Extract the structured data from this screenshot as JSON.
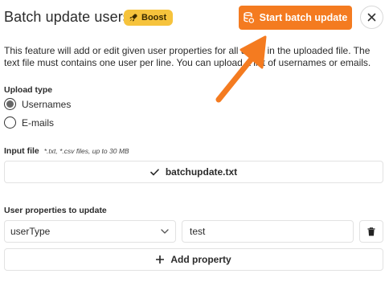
{
  "header": {
    "title": "Batch update users",
    "badge_label": "Boost",
    "badge_icon": "rocket-icon",
    "start_button_label": "Start batch update",
    "start_button_icon": "database-sync-icon",
    "close_icon": "close-icon",
    "accent_color": "#f47b20",
    "badge_color": "#f6c33c"
  },
  "description": "This feature will add or edit given user properties for all users in the uploaded file. The text file must contains one user per line. You can upload a list of usernames or emails.",
  "upload_type": {
    "label": "Upload type",
    "options": [
      {
        "label": "Usernames",
        "checked": true
      },
      {
        "label": "E-mails",
        "checked": false
      }
    ]
  },
  "input_file": {
    "label": "Input file",
    "hint": "*.txt, *.csv files, up to 30 MB",
    "file_name": "batchupdate.txt",
    "status_icon": "check-icon"
  },
  "properties": {
    "label": "User properties to update",
    "rows": [
      {
        "property": "userType",
        "value": "test"
      }
    ],
    "add_label": "Add property",
    "delete_icon": "trash-icon"
  }
}
